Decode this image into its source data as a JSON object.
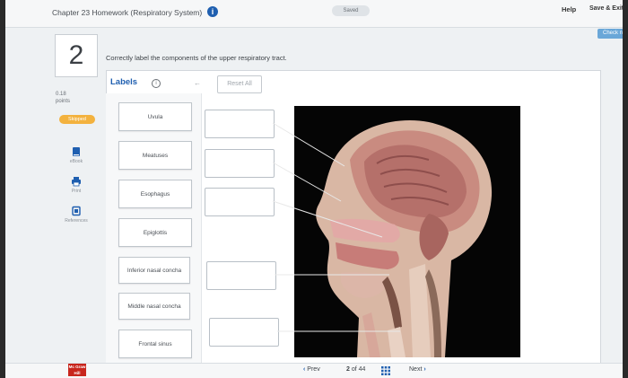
{
  "header": {
    "title": "Chapter 23 Homework (Respiratory System)",
    "info_icon": "info-icon",
    "saved": "Saved",
    "help": "Help",
    "save_exit": "Save & Exit",
    "check": "Check n"
  },
  "question": {
    "number": "2",
    "prompt": "Correctly label the components of the upper respiratory tract.",
    "points": "0.18",
    "points_label": "points",
    "status": "Skipped"
  },
  "side_tools": [
    {
      "label": "eBook",
      "icon": "book-icon"
    },
    {
      "label": "Print",
      "icon": "printer-icon"
    },
    {
      "label": "References",
      "icon": "references-icon"
    }
  ],
  "labels_panel": {
    "title": "Labels",
    "reset": "Reset All",
    "cards": [
      "Uvula",
      "Meatuses",
      "Esophagus",
      "Epiglottis",
      "Inferior nasal concha",
      "Middle nasal concha",
      "Frontal sinus"
    ]
  },
  "footer": {
    "prev": "Prev",
    "page_current": "2",
    "page_of": "of",
    "page_total": "44",
    "next": "Next",
    "logo_text": "Mc Graw Hill"
  },
  "colors": {
    "accent": "#1f5fb0",
    "skipped": "#f3b23e",
    "check_button": "#6aa7d8"
  }
}
